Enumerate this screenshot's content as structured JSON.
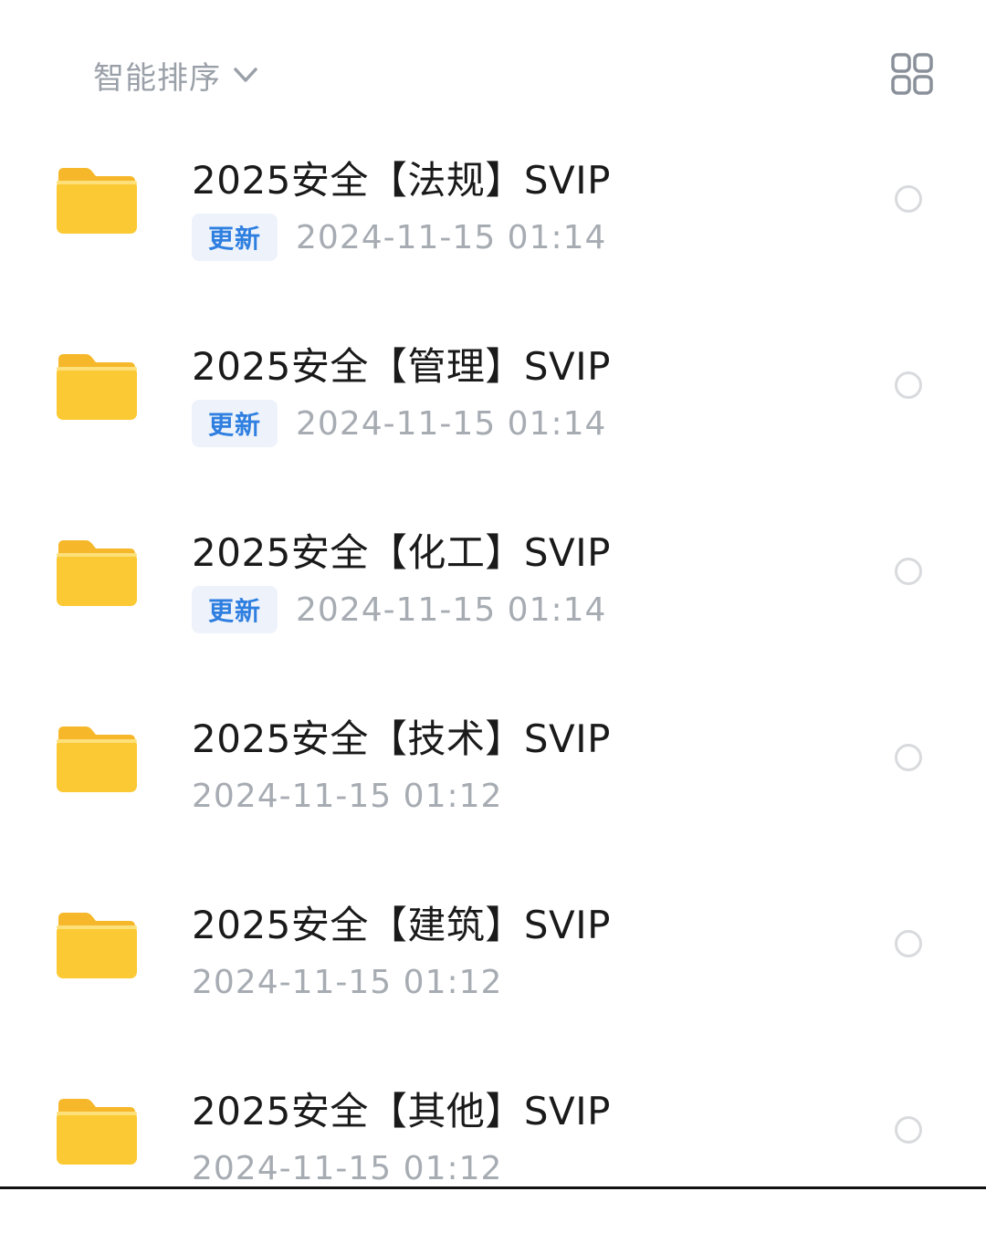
{
  "sort": {
    "label": "智能排序",
    "chevron_icon": "chevron-down-icon",
    "view_toggle_icon": "grid-view-icon"
  },
  "colors": {
    "folder": "#fbc934",
    "folder_tab": "#f6b82a",
    "badge_text": "#2f7fe0",
    "date_text": "#a7acb3"
  },
  "files": [
    {
      "name": "2025安全【法规】SVIP",
      "badge": "更新",
      "date": "2024-11-15  01:14"
    },
    {
      "name": "2025安全【管理】SVIP",
      "badge": "更新",
      "date": "2024-11-15  01:14"
    },
    {
      "name": "2025安全【化工】SVIP",
      "badge": "更新",
      "date": "2024-11-15  01:14"
    },
    {
      "name": "2025安全【技术】SVIP",
      "badge": "",
      "date": "2024-11-15  01:12"
    },
    {
      "name": "2025安全【建筑】SVIP",
      "badge": "",
      "date": "2024-11-15  01:12"
    },
    {
      "name": "2025安全【其他】SVIP",
      "badge": "",
      "date": "2024-11-15  01:12"
    }
  ]
}
